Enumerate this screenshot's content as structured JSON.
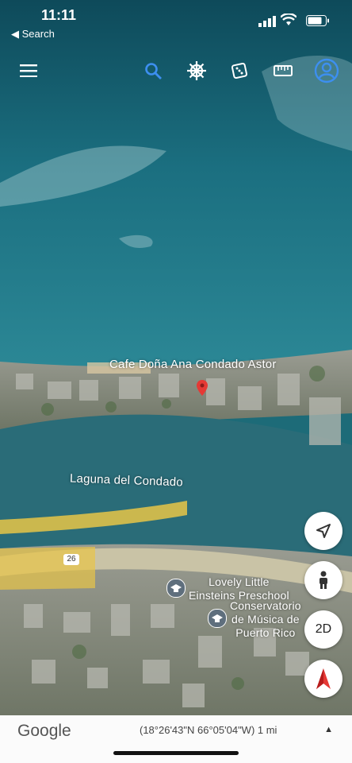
{
  "status_bar": {
    "time": "11:11",
    "back_label": "◀ Search"
  },
  "toolbar": {
    "icons": [
      "menu-icon",
      "search-icon",
      "voyager-wheel-icon",
      "dice-icon",
      "ruler-icon",
      "account-icon"
    ]
  },
  "map": {
    "labels": {
      "cafe": "Cafe Doña Ana Condado Astor",
      "laguna": "Laguna del Condado",
      "preschool": "Lovely Little\nEinsteins Preschool",
      "conservatorio": "Conservatorio\nde Música de\nPuerto Rico",
      "road_shield": "26"
    }
  },
  "controls": {
    "view_mode_label": "2D"
  },
  "bottom_bar": {
    "logo": "Google",
    "coordinates": "(18°26'43\"N 66°05'04\"W) 1 mi",
    "expand_symbol": "▲"
  },
  "colors": {
    "ocean": "#1f7382",
    "deep_ocean": "#0f4f5f",
    "lagoon": "#2a6c78",
    "land": "#8f9388",
    "road_highlight": "#e8c547",
    "accent_blue": "#2f80ed"
  }
}
